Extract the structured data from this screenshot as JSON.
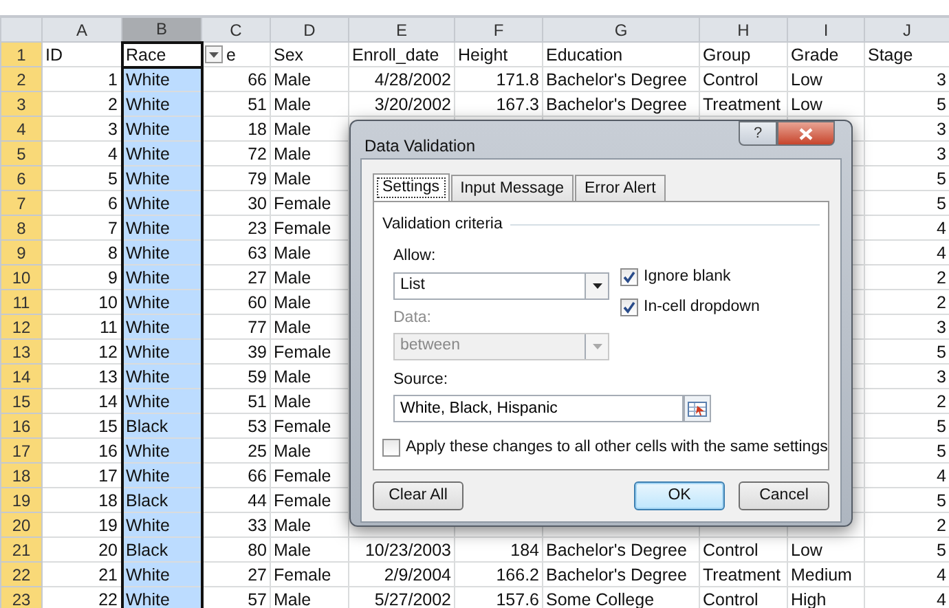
{
  "columns": [
    {
      "letter": "A",
      "numeric": true,
      "selected": false
    },
    {
      "letter": "B",
      "numeric": false,
      "selected": true
    },
    {
      "letter": "C",
      "numeric": true,
      "selected": false
    },
    {
      "letter": "D",
      "numeric": false,
      "selected": false
    },
    {
      "letter": "E",
      "numeric": true,
      "selected": false
    },
    {
      "letter": "F",
      "numeric": true,
      "selected": false
    },
    {
      "letter": "G",
      "numeric": false,
      "selected": false
    },
    {
      "letter": "H",
      "numeric": false,
      "selected": false
    },
    {
      "letter": "I",
      "numeric": false,
      "selected": false
    },
    {
      "letter": "J",
      "numeric": true,
      "selected": false
    }
  ],
  "header_row": {
    "number": "1",
    "selected": true,
    "cells": [
      {
        "text": "ID",
        "active": false
      },
      {
        "text": "Race",
        "active": true
      },
      {
        "text": "e",
        "active": false
      },
      {
        "text": "Sex",
        "active": false
      },
      {
        "text": "Enroll_date",
        "active": false
      },
      {
        "text": "Height",
        "active": false
      },
      {
        "text": "Education",
        "active": false
      },
      {
        "text": "Group",
        "active": false
      },
      {
        "text": "Grade",
        "active": false
      },
      {
        "text": "Stage",
        "active": false
      }
    ]
  },
  "rows": [
    {
      "number": "2",
      "selected": true,
      "cells": {
        "A": "1",
        "B": "White",
        "C": "66",
        "D": "Male",
        "E": "4/28/2002",
        "F": "171.8",
        "G": "Bachelor's Degree",
        "H": "Control",
        "I": "Low",
        "J": "3"
      }
    },
    {
      "number": "3",
      "selected": true,
      "cells": {
        "A": "2",
        "B": "White",
        "C": "51",
        "D": "Male",
        "E": "3/20/2002",
        "F": "167.3",
        "G": "Bachelor's Degree",
        "H": "Treatment",
        "I": "Low",
        "J": "5"
      }
    },
    {
      "number": "4",
      "selected": true,
      "cells": {
        "A": "3",
        "B": "White",
        "C": "18",
        "D": "Male",
        "J": "3"
      }
    },
    {
      "number": "5",
      "selected": true,
      "cells": {
        "A": "4",
        "B": "White",
        "C": "72",
        "D": "Male",
        "J": "3"
      }
    },
    {
      "number": "6",
      "selected": true,
      "cells": {
        "A": "5",
        "B": "White",
        "C": "79",
        "D": "Male",
        "J": "5"
      }
    },
    {
      "number": "7",
      "selected": true,
      "cells": {
        "A": "6",
        "B": "White",
        "C": "30",
        "D": "Female",
        "J": "5"
      }
    },
    {
      "number": "8",
      "selected": true,
      "cells": {
        "A": "7",
        "B": "White",
        "C": "23",
        "D": "Female",
        "J": "4"
      }
    },
    {
      "number": "9",
      "selected": true,
      "cells": {
        "A": "8",
        "B": "White",
        "C": "63",
        "D": "Male",
        "J": "4"
      }
    },
    {
      "number": "10",
      "selected": true,
      "cells": {
        "A": "9",
        "B": "White",
        "C": "27",
        "D": "Male",
        "J": "2"
      }
    },
    {
      "number": "11",
      "selected": true,
      "cells": {
        "A": "10",
        "B": "White",
        "C": "60",
        "D": "Male",
        "J": "2"
      }
    },
    {
      "number": "12",
      "selected": true,
      "cells": {
        "A": "11",
        "B": "White",
        "C": "77",
        "D": "Male",
        "J": "3"
      }
    },
    {
      "number": "13",
      "selected": true,
      "cells": {
        "A": "12",
        "B": "White",
        "C": "39",
        "D": "Female",
        "J": "5"
      }
    },
    {
      "number": "14",
      "selected": true,
      "cells": {
        "A": "13",
        "B": "White",
        "C": "59",
        "D": "Male",
        "J": "3"
      }
    },
    {
      "number": "15",
      "selected": true,
      "cells": {
        "A": "14",
        "B": "White",
        "C": "51",
        "D": "Male",
        "J": "2"
      }
    },
    {
      "number": "16",
      "selected": true,
      "cells": {
        "A": "15",
        "B": "Black",
        "C": "53",
        "D": "Female",
        "J": "5"
      }
    },
    {
      "number": "17",
      "selected": true,
      "cells": {
        "A": "16",
        "B": "White",
        "C": "25",
        "D": "Male",
        "J": "5"
      }
    },
    {
      "number": "18",
      "selected": true,
      "cells": {
        "A": "17",
        "B": "White",
        "C": "66",
        "D": "Female",
        "J": "4"
      }
    },
    {
      "number": "19",
      "selected": true,
      "cells": {
        "A": "18",
        "B": "Black",
        "C": "44",
        "D": "Female",
        "J": "5"
      }
    },
    {
      "number": "20",
      "selected": true,
      "cells": {
        "A": "19",
        "B": "White",
        "C": "33",
        "D": "Male",
        "J": "2"
      }
    },
    {
      "number": "21",
      "selected": true,
      "cells": {
        "A": "20",
        "B": "Black",
        "C": "80",
        "D": "Male",
        "E": "10/23/2003",
        "F": "184",
        "G": "Bachelor's Degree",
        "H": "Control",
        "I": "Low",
        "J": "5"
      }
    },
    {
      "number": "22",
      "selected": true,
      "cells": {
        "A": "21",
        "B": "White",
        "C": "27",
        "D": "Female",
        "E": "2/9/2004",
        "F": "166.2",
        "G": "Bachelor's Degree",
        "H": "Treatment",
        "I": "Medium",
        "J": "4"
      }
    },
    {
      "number": "23",
      "selected": true,
      "cells": {
        "A": "22",
        "B": "White",
        "C": "57",
        "D": "Male",
        "E": "5/27/2002",
        "F": "157.6",
        "G": "Some College",
        "H": "Control",
        "I": "High",
        "J": "4"
      }
    }
  ],
  "dialog": {
    "title": "Data Validation",
    "help": "?",
    "tabs": [
      {
        "label": "Settings",
        "selected": true
      },
      {
        "label": "Input Message",
        "selected": false
      },
      {
        "label": "Error Alert",
        "selected": false
      }
    ],
    "group_title": "Validation criteria",
    "allow": {
      "label": "Allow:",
      "value": "List",
      "disabled": false
    },
    "data": {
      "label": "Data:",
      "value": "between",
      "disabled": true
    },
    "checkboxes": [
      {
        "label": "Ignore blank",
        "checked": true
      },
      {
        "label": "In-cell dropdown",
        "checked": true
      }
    ],
    "source": {
      "label": "Source:",
      "value": "White, Black, Hispanic"
    },
    "apply_all": {
      "label": "Apply these changes to all other cells with the same settings",
      "checked": false
    },
    "buttons": [
      {
        "label": "Clear All",
        "default": false
      },
      {
        "label": "OK",
        "default": true
      },
      {
        "label": "Cancel",
        "default": false
      }
    ]
  }
}
